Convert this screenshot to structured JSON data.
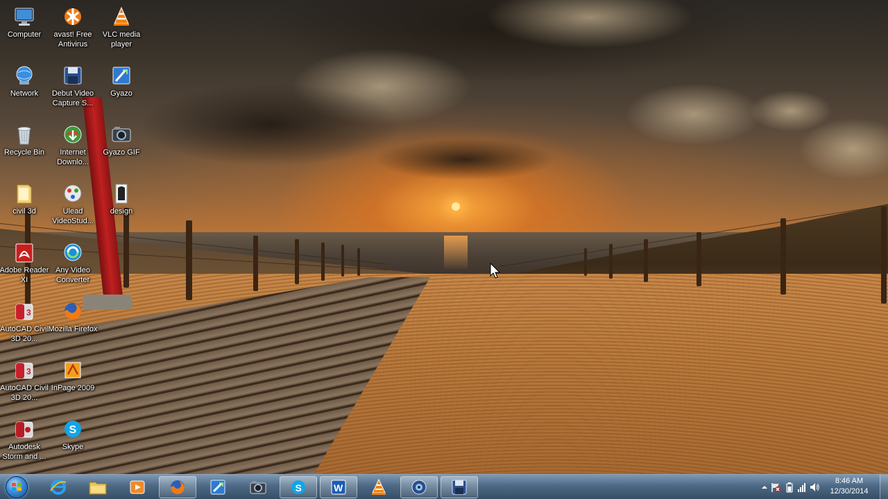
{
  "desktop": {
    "icons": [
      {
        "label": "Computer",
        "icon": "computer-icon"
      },
      {
        "label": "avast! Free Antivirus",
        "icon": "avast-icon"
      },
      {
        "label": "VLC media player",
        "icon": "vlc-icon"
      },
      {
        "label": "Network",
        "icon": "network-icon"
      },
      {
        "label": "Debut Video Capture S...",
        "icon": "debut-icon"
      },
      {
        "label": "Gyazo",
        "icon": "gyazo-icon"
      },
      {
        "label": "Recycle Bin",
        "icon": "recycle-bin-icon"
      },
      {
        "label": "Internet Downlo...",
        "icon": "idm-icon"
      },
      {
        "label": "Gyazo GIF",
        "icon": "gyazo-gif-icon"
      },
      {
        "label": "civil 3d",
        "icon": "folder-icon"
      },
      {
        "label": "Ulead VideoStud...",
        "icon": "ulead-icon"
      },
      {
        "label": "design",
        "icon": "design-icon"
      },
      {
        "label": "Adobe Reader XI",
        "icon": "adobe-reader-icon"
      },
      {
        "label": "Any Video Converter",
        "icon": "any-video-converter-icon"
      },
      {
        "label": "AutoCAD Civil 3D 20...",
        "icon": "autocad-civil-icon"
      },
      {
        "label": "Mozilla Firefox",
        "icon": "firefox-icon"
      },
      {
        "label": "AutoCAD Civil 3D 20...",
        "icon": "autocad-civil-icon"
      },
      {
        "label": "InPage 2009",
        "icon": "inpage-icon"
      },
      {
        "label": "Autodesk Storm and ...",
        "icon": "autodesk-storm-icon"
      },
      {
        "label": "Skype",
        "icon": "skype-icon"
      }
    ]
  },
  "taskbar": {
    "start": {
      "icon": "windows-start-orb-icon"
    },
    "pinned": [
      {
        "icon": "internet-explorer-icon"
      },
      {
        "icon": "file-explorer-icon"
      },
      {
        "icon": "media-player-icon"
      },
      {
        "icon": "firefox-icon"
      },
      {
        "icon": "gyazo-icon"
      },
      {
        "icon": "debut-video-capture-icon"
      },
      {
        "icon": "skype-icon"
      },
      {
        "icon": "word-icon"
      },
      {
        "icon": "vlc-icon"
      },
      {
        "icon": "recorder-icon"
      },
      {
        "icon": "save-icon"
      }
    ],
    "tray": {
      "icons": [
        "show-hidden-icons-icon",
        "flag-icon",
        "battery-icon",
        "network-signal-icon",
        "volume-icon"
      ],
      "time": "8:46 AM",
      "date": "12/30/2014"
    }
  }
}
